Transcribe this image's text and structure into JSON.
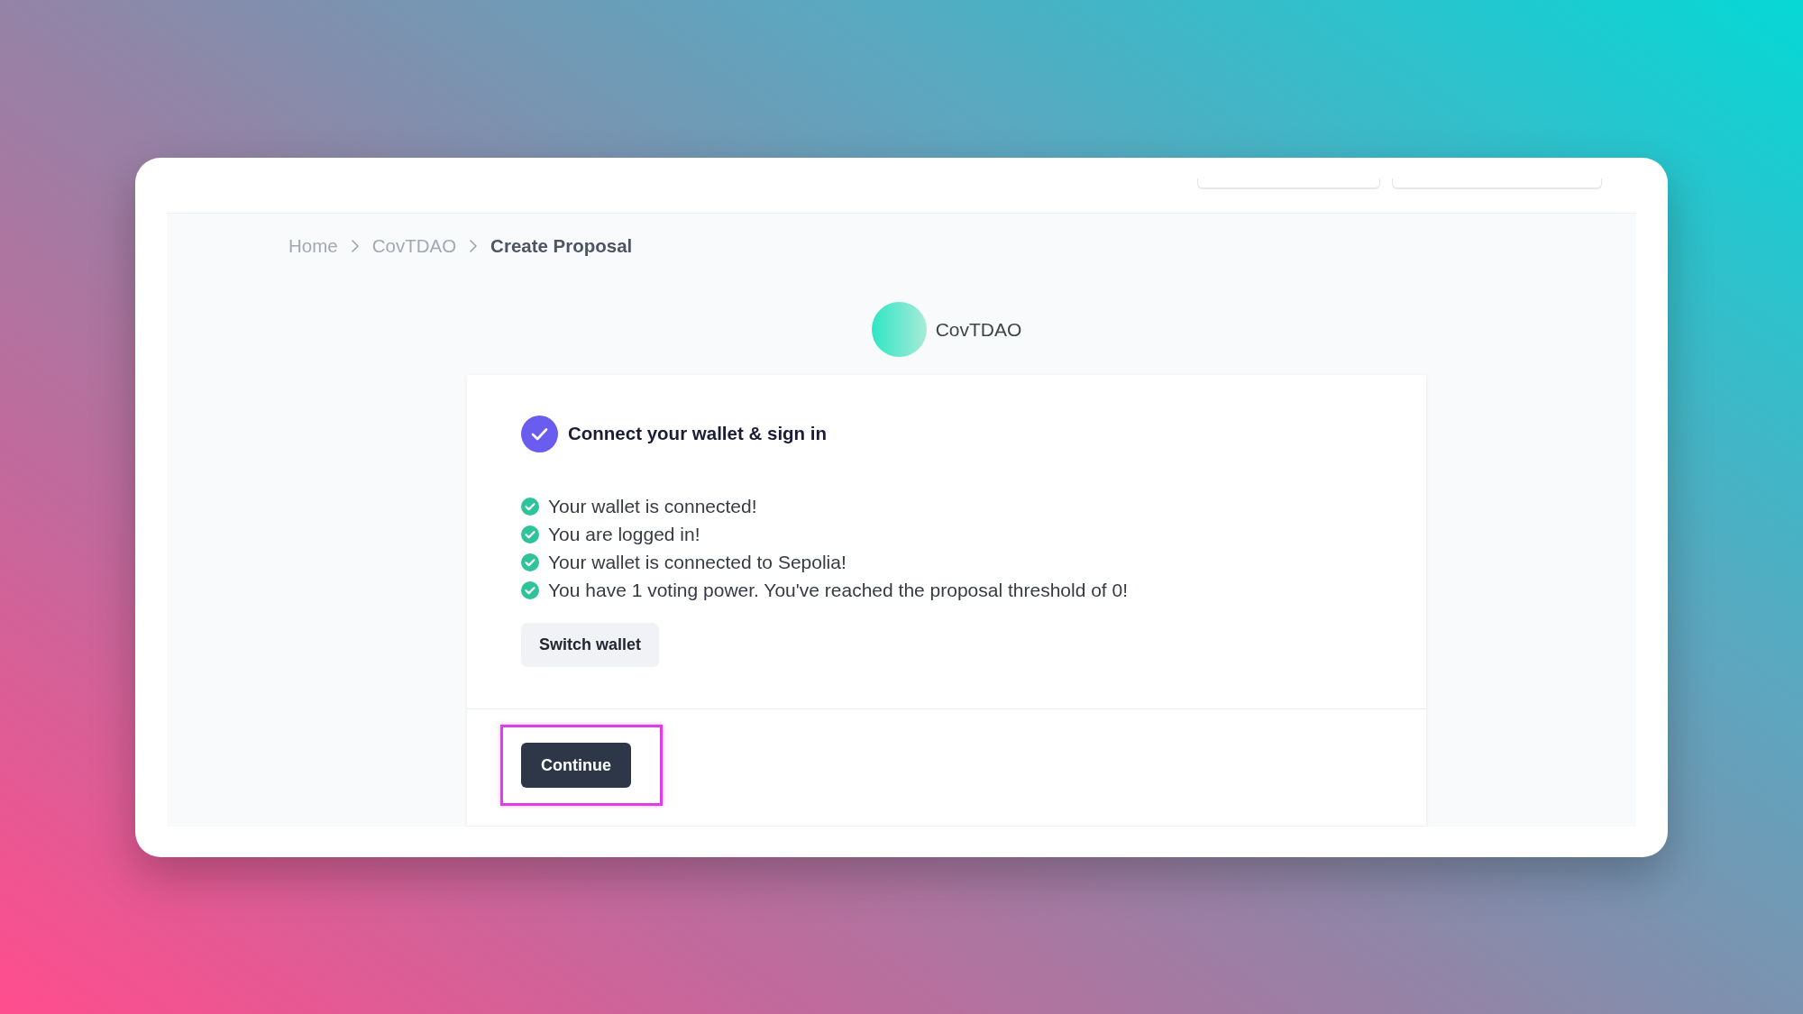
{
  "breadcrumb": [
    {
      "label": "Home",
      "current": false
    },
    {
      "label": "CovTDAO",
      "current": false
    },
    {
      "label": "Create Proposal",
      "current": true
    }
  ],
  "dao": {
    "name": "CovTDAO"
  },
  "step": {
    "title": "Connect your wallet & sign in",
    "completed": true
  },
  "checks": [
    {
      "text": "Your wallet is connected!",
      "done": true
    },
    {
      "text": "You are logged in!",
      "done": true
    },
    {
      "text": "Your wallet is connected to Sepolia!",
      "done": true
    },
    {
      "text": "You have 1 voting power. You've reached the proposal threshold of 0!",
      "done": true
    }
  ],
  "switch_button": {
    "label": "Switch wallet"
  },
  "continue_button": {
    "label": "Continue",
    "highlighted": true
  }
}
